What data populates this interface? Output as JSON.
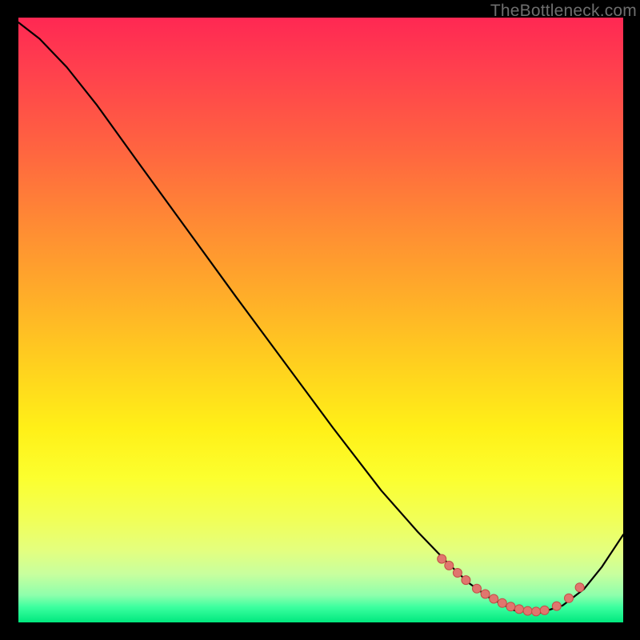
{
  "watermark": {
    "text": "TheBottleneck.com"
  },
  "colors": {
    "curve_stroke": "#000000",
    "marker_fill": "#e0766e",
    "marker_stroke": "#c44d47",
    "gradient_stops": [
      [
        "0%",
        "#ff2853"
      ],
      [
        "8%",
        "#ff3e4e"
      ],
      [
        "22%",
        "#ff6540"
      ],
      [
        "34%",
        "#ff8a34"
      ],
      [
        "47%",
        "#ffb028"
      ],
      [
        "58%",
        "#ffd21e"
      ],
      [
        "68%",
        "#fff018"
      ],
      [
        "76%",
        "#fcff2e"
      ],
      [
        "83%",
        "#f1ff58"
      ],
      [
        "88%",
        "#e4ff7e"
      ],
      [
        "92%",
        "#c8ff9e"
      ],
      [
        "95.5%",
        "#8effac"
      ],
      [
        "97.5%",
        "#3bff9f"
      ],
      [
        "100%",
        "#00e87e"
      ]
    ]
  },
  "chart_data": {
    "type": "line",
    "title": "",
    "xlabel": "",
    "ylabel": "",
    "notes": "No axis tick labels are rendered in the source image; x and y are in normalized 0–1 plot-area coordinates (y=0 at bottom). The curve descends steeply from top-left, bottoms out near x≈0.82–0.86, then rises slightly. Markers lie on the curve near the trough.",
    "xlim": [
      0,
      1
    ],
    "ylim": [
      0,
      1
    ],
    "series": [
      {
        "name": "curve",
        "kind": "line",
        "x": [
          0.0,
          0.035,
          0.08,
          0.13,
          0.2,
          0.28,
          0.36,
          0.44,
          0.52,
          0.6,
          0.66,
          0.71,
          0.745,
          0.78,
          0.82,
          0.86,
          0.9,
          0.935,
          0.965,
          1.0
        ],
        "y": [
          0.992,
          0.965,
          0.918,
          0.855,
          0.758,
          0.648,
          0.538,
          0.43,
          0.322,
          0.218,
          0.15,
          0.098,
          0.065,
          0.04,
          0.02,
          0.015,
          0.028,
          0.055,
          0.092,
          0.145
        ]
      },
      {
        "name": "markers",
        "kind": "scatter",
        "x": [
          0.7,
          0.712,
          0.726,
          0.74,
          0.758,
          0.772,
          0.786,
          0.8,
          0.814,
          0.828,
          0.842,
          0.856,
          0.87,
          0.89,
          0.91,
          0.928
        ],
        "y": [
          0.105,
          0.094,
          0.082,
          0.07,
          0.056,
          0.047,
          0.039,
          0.032,
          0.026,
          0.022,
          0.019,
          0.018,
          0.02,
          0.027,
          0.04,
          0.058
        ]
      }
    ]
  }
}
